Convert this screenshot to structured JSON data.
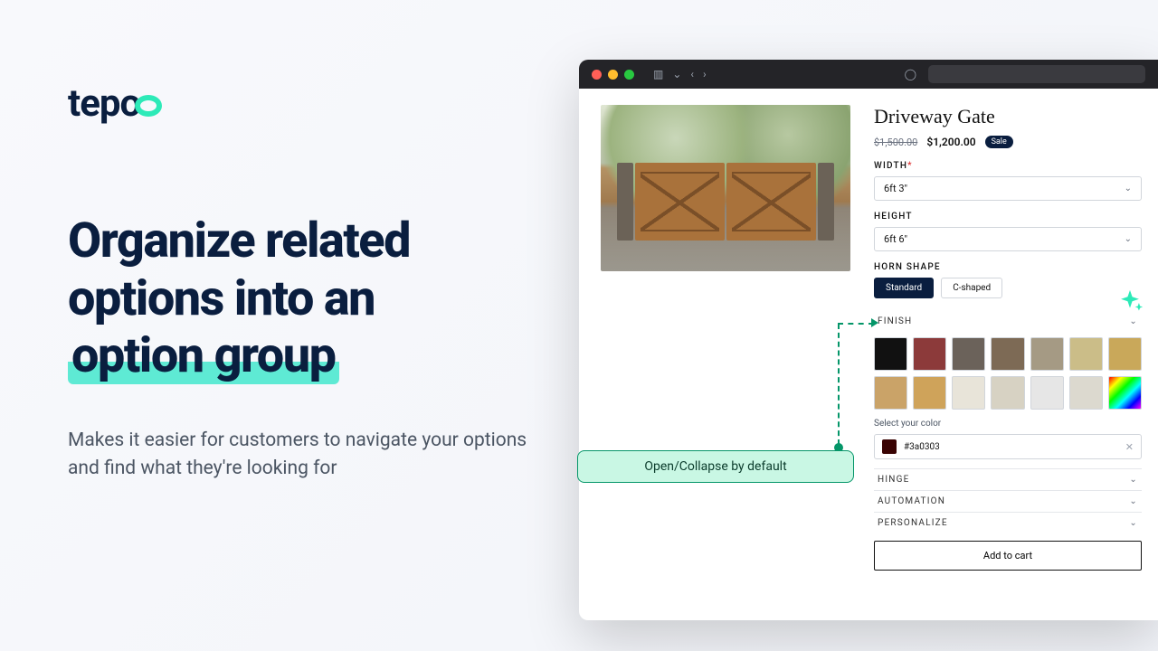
{
  "brand": {
    "name": "tepo"
  },
  "headline": {
    "line1": "Organize related",
    "line2": "options into an",
    "line3_highlight": "option group"
  },
  "subhead": "Makes it easier for customers to navigate your options and find what they're looking for",
  "callout": {
    "label": "Open/Collapse by default"
  },
  "product": {
    "title": "Driveway Gate",
    "price_old": "$1,500.00",
    "price_new": "$1,200.00",
    "sale_badge": "Sale",
    "options": {
      "width": {
        "label": "WIDTH",
        "required": true,
        "value": "6ft 3\""
      },
      "height": {
        "label": "HEIGHT",
        "required": false,
        "value": "6ft 6\""
      },
      "horn_shape": {
        "label": "HORN SHAPE",
        "values": [
          "Standard",
          "C-shaped"
        ],
        "selected": "Standard"
      },
      "finish": {
        "label": "FINISH",
        "swatches": [
          "#111111",
          "#8c3a3a",
          "#6b625a",
          "#7d6a55",
          "#a59a84",
          "#cbbd88",
          "#c9a85a",
          "#caa368",
          "#cfa35a",
          "#e8e4d9",
          "#d7d2c3",
          "#e6e6e6",
          "#dcd9cf",
          "linear-gradient(135deg,#f00,#ff0,#0f0,#0ff,#00f,#f0f)"
        ],
        "color_label": "Select your color",
        "color_value": "#3a0303"
      },
      "collapsed_groups": [
        "HINGE",
        "AUTOMATION",
        "PERSONALIZE"
      ]
    },
    "cart_button": "Add to cart"
  }
}
